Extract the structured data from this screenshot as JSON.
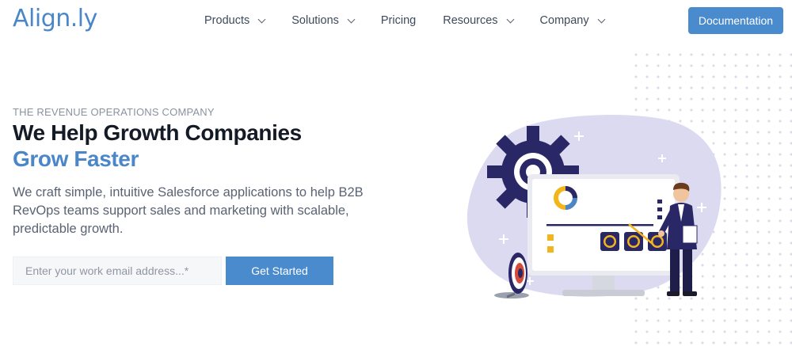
{
  "header": {
    "logo": "Align.ly",
    "nav": [
      {
        "label": "Products",
        "has_dropdown": true
      },
      {
        "label": "Solutions",
        "has_dropdown": true
      },
      {
        "label": "Pricing",
        "has_dropdown": false
      },
      {
        "label": "Resources",
        "has_dropdown": true
      },
      {
        "label": "Company",
        "has_dropdown": true
      }
    ],
    "cta_label": "Documentation"
  },
  "hero": {
    "eyebrow": "THE REVENUE OPERATIONS COMPANY",
    "headline_line1": "We Help Growth Companies",
    "headline_line2": "Grow Faster",
    "description": "We craft simple, intuitive Salesforce applications to help B2B RevOps teams support sales and marketing with scalable, predictable growth.",
    "email_placeholder": "Enter your work email address...*",
    "cta_label": "Get Started"
  },
  "colors": {
    "brand_blue": "#4a86c8",
    "button_blue": "#4a8bcd",
    "illustration_lavender": "#dcdaf0",
    "gear_navy": "#2a2766",
    "accent_yellow": "#f2b51c"
  },
  "icons": [
    "chevron-down-icon",
    "gear-icon",
    "target-icon",
    "donut-chart-icon"
  ]
}
